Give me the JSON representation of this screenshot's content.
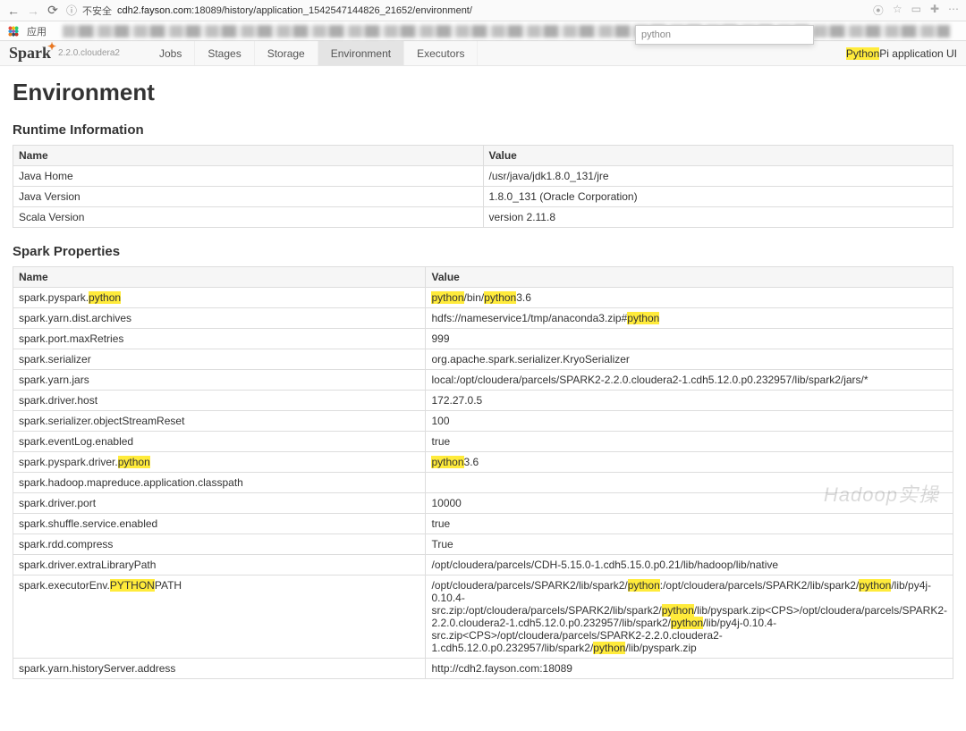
{
  "browser": {
    "insecure_label": "不安全",
    "url_host": "cdh2.fayson.com",
    "url_path": ":18089/history/application_1542547144826_21652/environment/",
    "apps_label": "应用",
    "find_text": "python"
  },
  "header": {
    "logo_text": "Spark",
    "version": "2.2.0.cloudera2",
    "tabs": [
      {
        "label": "Jobs"
      },
      {
        "label": "Stages"
      },
      {
        "label": "Storage"
      },
      {
        "label": "Environment",
        "active": true
      },
      {
        "label": "Executors"
      }
    ],
    "app_name_prefix": "Python",
    "app_name_suffix": "Pi application UI"
  },
  "page_title": "Environment",
  "runtime_section": {
    "title": "Runtime Information",
    "headers": [
      "Name",
      "Value"
    ],
    "rows": [
      {
        "name": "Java Home",
        "value": "/usr/java/jdk1.8.0_131/jre"
      },
      {
        "name": "Java Version",
        "value": "1.8.0_131 (Oracle Corporation)"
      },
      {
        "name": "Scala Version",
        "value": "version 2.11.8"
      }
    ]
  },
  "spark_section": {
    "title": "Spark Properties",
    "headers": [
      "Name",
      "Value"
    ],
    "rows": [
      {
        "name_html": "spark.pyspark.<span class='hl'>python</span>",
        "value_html": "<span class='hl'>python</span>/bin/<span class='hl'>python</span>3.6"
      },
      {
        "name_html": "spark.yarn.dist.archives",
        "value_html": "hdfs://nameservice1/tmp/anaconda3.zip#<span class='hl'>python</span>"
      },
      {
        "name_html": "spark.port.maxRetries",
        "value_html": "999"
      },
      {
        "name_html": "spark.serializer",
        "value_html": "org.apache.spark.serializer.KryoSerializer"
      },
      {
        "name_html": "spark.yarn.jars",
        "value_html": "local:/opt/cloudera/parcels/SPARK2-2.2.0.cloudera2-1.cdh5.12.0.p0.232957/lib/spark2/jars/*"
      },
      {
        "name_html": "spark.driver.host",
        "value_html": "172.27.0.5"
      },
      {
        "name_html": "spark.serializer.objectStreamReset",
        "value_html": "100"
      },
      {
        "name_html": "spark.eventLog.enabled",
        "value_html": "true"
      },
      {
        "name_html": "spark.pyspark.driver.<span class='hl'>python</span>",
        "value_html": "<span class='hl'>python</span>3.6"
      },
      {
        "name_html": "spark.hadoop.mapreduce.application.classpath",
        "value_html": ""
      },
      {
        "name_html": "spark.driver.port",
        "value_html": "10000"
      },
      {
        "name_html": "spark.shuffle.service.enabled",
        "value_html": "true"
      },
      {
        "name_html": "spark.rdd.compress",
        "value_html": "True"
      },
      {
        "name_html": "spark.driver.extraLibraryPath",
        "value_html": "/opt/cloudera/parcels/CDH-5.15.0-1.cdh5.15.0.p0.21/lib/hadoop/lib/native"
      },
      {
        "name_html": "spark.executorEnv.<span class='hl'>PYTHON</span>PATH",
        "value_html": "/opt/cloudera/parcels/SPARK2/lib/spark2/<span class='hl'>python</span>:/opt/cloudera/parcels/SPARK2/lib/spark2/<span class='hl'>python</span>/lib/py4j-0.10.4-src.zip:/opt/cloudera/parcels/SPARK2/lib/spark2/<span class='hl'>python</span>/lib/pyspark.zip&lt;CPS&gt;/opt/cloudera/parcels/SPARK2-2.2.0.cloudera2-1.cdh5.12.0.p0.232957/lib/spark2/<span class='hl'>python</span>/lib/py4j-0.10.4-src.zip&lt;CPS&gt;/opt/cloudera/parcels/SPARK2-2.2.0.cloudera2-1.cdh5.12.0.p0.232957/lib/spark2/<span class='hl'>python</span>/lib/pyspark.zip"
      },
      {
        "name_html": "spark.yarn.historyServer.address",
        "value_html": "http://cdh2.fayson.com:18089"
      }
    ]
  },
  "watermark": "Hadoop实操"
}
